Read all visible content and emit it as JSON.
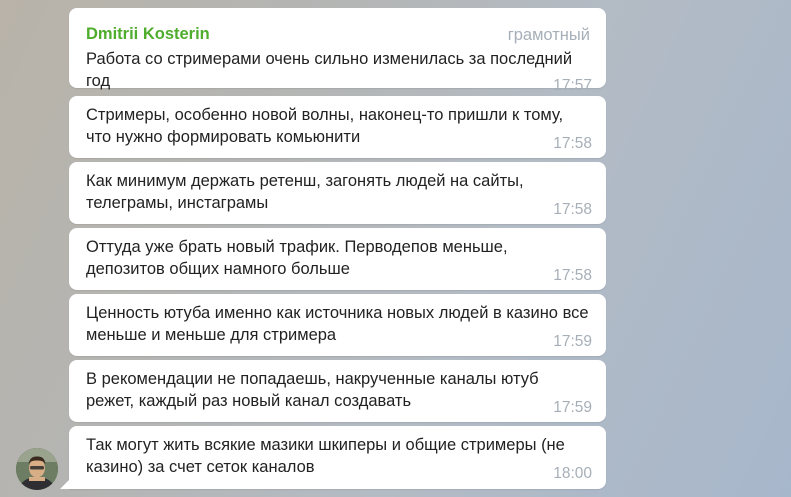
{
  "chat": {
    "sender_name": "Dmitrii Kosterin",
    "sender_badge": "грамотный",
    "messages": [
      {
        "text": "Работа со стримерами очень сильно изменилась за последний год",
        "time": "17:57"
      },
      {
        "text": "Стримеры, особенно новой волны, наконец-то пришли к тому, что нужно формировать комьюнити",
        "time": "17:58"
      },
      {
        "text": "Как минимум держать ретенш, загонять людей на сайты, телеграмы, инстаграмы",
        "time": "17:58"
      },
      {
        "text": "Оттуда уже брать новый трафик. Перводепов меньше, депозитов общих намного больше",
        "time": "17:58"
      },
      {
        "text": "Ценность ютуба именно как источника новых людей в казино все меньше и меньше для стримера",
        "time": "17:59"
      },
      {
        "text": "В рекомендации не попадаешь, накрученные каналы ютуб режет, каждый раз новый канал создавать",
        "time": "17:59"
      },
      {
        "text": "Так могут жить всякие мазики шкиперы и общие стримеры (не казино) за счет сеток каналов",
        "time": "18:00"
      }
    ]
  },
  "colors": {
    "sender_name": "#4fad2d",
    "timestamp": "#a6afb8",
    "bubble": "#ffffff"
  }
}
